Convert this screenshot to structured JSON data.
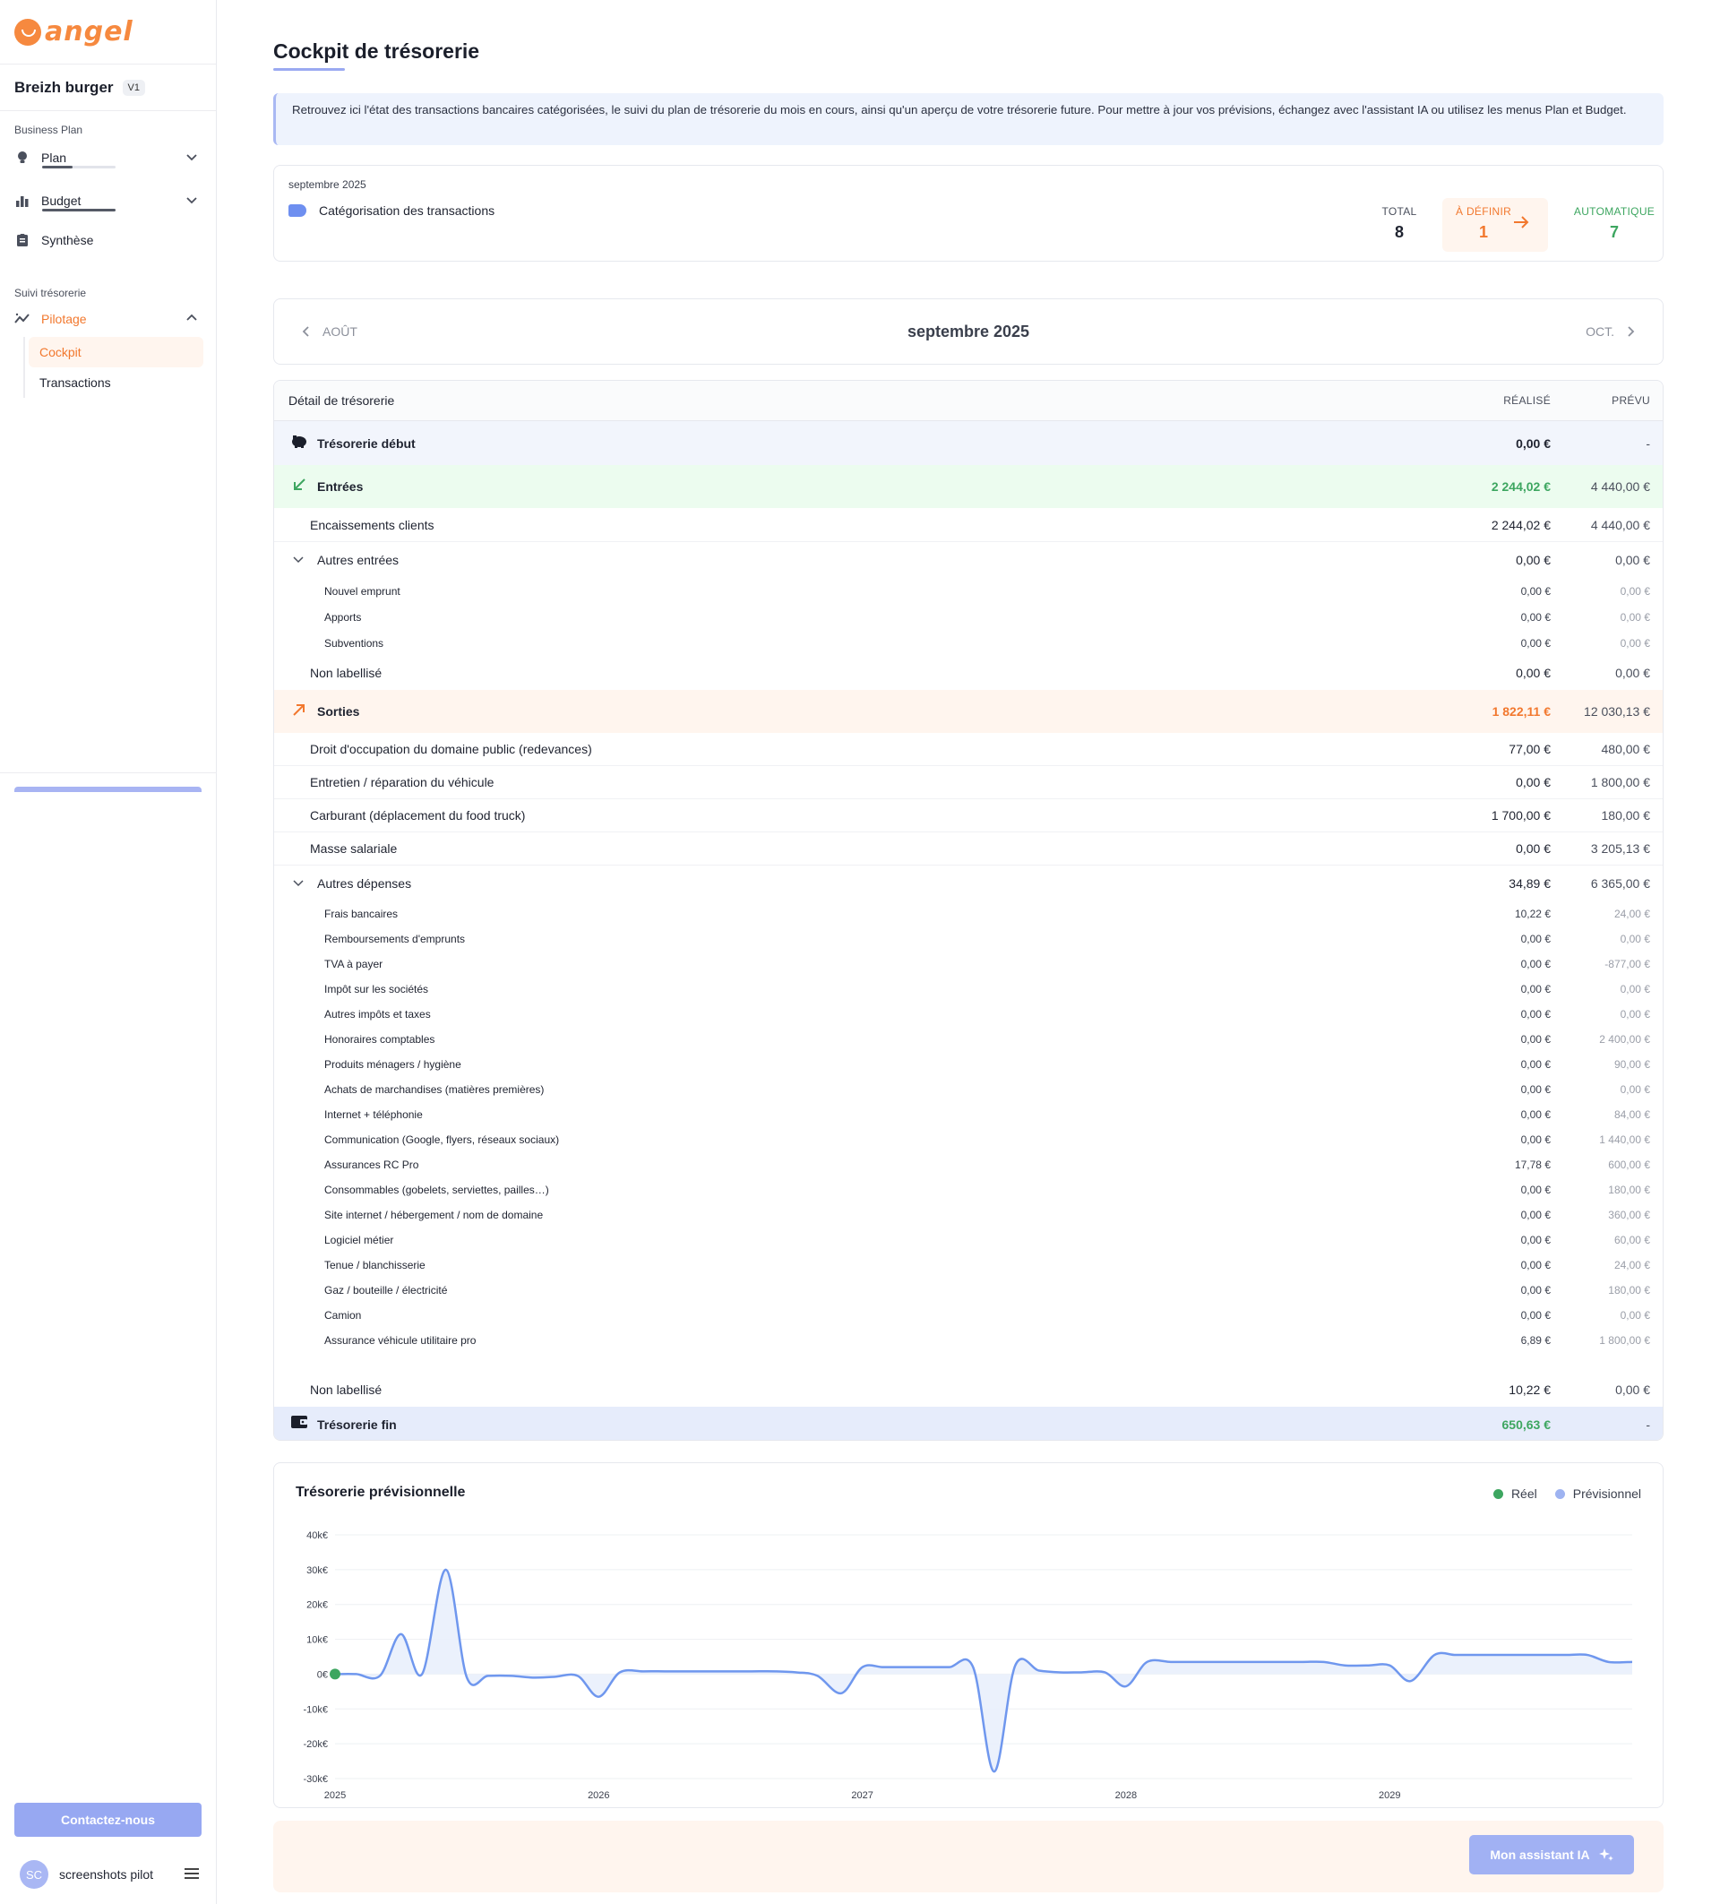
{
  "brand": {
    "name": "angel"
  },
  "project": {
    "name": "Breizh burger",
    "version": "V1"
  },
  "sidebar": {
    "section_business": "Business Plan",
    "plan_label": "Plan",
    "budget_label": "Budget",
    "synthese_label": "Synthèse",
    "section_suivi": "Suivi trésorerie",
    "pilotage_label": "Pilotage",
    "sub_items": [
      "Cockpit",
      "Transactions"
    ],
    "contact_label": "Contactez-nous",
    "user_initials": "SC",
    "user_name": "screenshots pilot"
  },
  "page": {
    "title": "Cockpit de trésorerie",
    "info": "Retrouvez ici l'état des transactions bancaires catégorisées, le suivi du plan de trésorerie du mois en cours, ainsi qu'un aperçu de votre trésorerie future. Pour mettre à jour vos prévisions, échangez avec l'assistant IA ou utilisez les menus Plan et Budget."
  },
  "categorisation": {
    "month": "septembre 2025",
    "label": "Catégorisation des transactions",
    "total_label": "TOTAL",
    "total_value": "8",
    "define_label": "À DÉFINIR",
    "define_value": "1",
    "auto_label": "AUTOMATIQUE",
    "auto_value": "7"
  },
  "month_nav": {
    "prev": "AOÛT",
    "current": "septembre 2025",
    "next": "OCT."
  },
  "treasury": {
    "header": {
      "label": "Détail de trésorerie",
      "realise": "RÉALISÉ",
      "prevu": "PRÉVU"
    },
    "debut": {
      "label": "Trésorerie début",
      "realise": "0,00 €",
      "prevu": "-"
    },
    "entrees": {
      "label": "Entrées",
      "realise": "2 244,02 €",
      "prevu": "4 440,00 €"
    },
    "encaissements": {
      "label": "Encaissements clients",
      "realise": "2 244,02 €",
      "prevu": "4 440,00 €"
    },
    "autres_entrees": {
      "label": "Autres entrées",
      "realise": "0,00 €",
      "prevu": "0,00 €"
    },
    "autres_entrees_items": [
      {
        "label": "Nouvel emprunt",
        "realise": "0,00 €",
        "prevu": "0,00 €"
      },
      {
        "label": "Apports",
        "realise": "0,00 €",
        "prevu": "0,00 €"
      },
      {
        "label": "Subventions",
        "realise": "0,00 €",
        "prevu": "0,00 €"
      }
    ],
    "non_labellise_in": {
      "label": "Non labellisé",
      "realise": "0,00 €",
      "prevu": "0,00 €"
    },
    "sorties": {
      "label": "Sorties",
      "realise": "1 822,11 €",
      "prevu": "12 030,13 €"
    },
    "sorties_items": [
      {
        "label": "Droit d'occupation du domaine public (redevances)",
        "realise": "77,00 €",
        "prevu": "480,00 €"
      },
      {
        "label": "Entretien / réparation du véhicule",
        "realise": "0,00 €",
        "prevu": "1 800,00 €"
      },
      {
        "label": "Carburant (déplacement du food truck)",
        "realise": "1 700,00 €",
        "prevu": "180,00 €"
      },
      {
        "label": "Masse salariale",
        "realise": "0,00 €",
        "prevu": "3 205,13 €"
      }
    ],
    "autres_depenses": {
      "label": "Autres dépenses",
      "realise": "34,89 €",
      "prevu": "6 365,00 €"
    },
    "autres_depenses_items": [
      {
        "label": "Frais bancaires",
        "realise": "10,22 €",
        "prevu": "24,00 €"
      },
      {
        "label": "Remboursements d'emprunts",
        "realise": "0,00 €",
        "prevu": "0,00 €"
      },
      {
        "label": "TVA à payer",
        "realise": "0,00 €",
        "prevu": "-877,00 €"
      },
      {
        "label": "Impôt sur les sociétés",
        "realise": "0,00 €",
        "prevu": "0,00 €"
      },
      {
        "label": "Autres impôts et taxes",
        "realise": "0,00 €",
        "prevu": "0,00 €"
      },
      {
        "label": "Honoraires comptables",
        "realise": "0,00 €",
        "prevu": "2 400,00 €"
      },
      {
        "label": "Produits ménagers / hygiène",
        "realise": "0,00 €",
        "prevu": "90,00 €"
      },
      {
        "label": "Achats de marchandises (matières premières)",
        "realise": "0,00 €",
        "prevu": "0,00 €"
      },
      {
        "label": "Internet + téléphonie",
        "realise": "0,00 €",
        "prevu": "84,00 €"
      },
      {
        "label": "Communication (Google, flyers, réseaux sociaux)",
        "realise": "0,00 €",
        "prevu": "1 440,00 €"
      },
      {
        "label": "Assurances RC Pro",
        "realise": "17,78 €",
        "prevu": "600,00 €"
      },
      {
        "label": "Consommables (gobelets, serviettes, pailles…)",
        "realise": "0,00 €",
        "prevu": "180,00 €"
      },
      {
        "label": "Site internet / hébergement / nom de domaine",
        "realise": "0,00 €",
        "prevu": "360,00 €"
      },
      {
        "label": "Logiciel métier",
        "realise": "0,00 €",
        "prevu": "60,00 €"
      },
      {
        "label": "Tenue / blanchisserie",
        "realise": "0,00 €",
        "prevu": "24,00 €"
      },
      {
        "label": "Gaz / bouteille / électricité",
        "realise": "0,00 €",
        "prevu": "180,00 €"
      },
      {
        "label": "Camion",
        "realise": "0,00 €",
        "prevu": "0,00 €"
      },
      {
        "label": "Assurance véhicule utilitaire pro",
        "realise": "6,89 €",
        "prevu": "1 800,00 €"
      }
    ],
    "non_labellise_out": {
      "label": "Non labellisé",
      "realise": "10,22 €",
      "prevu": "0,00 €"
    },
    "fin": {
      "label": "Trésorerie fin",
      "realise": "650,63 €",
      "prevu": "-"
    }
  },
  "chart_data": {
    "type": "line",
    "title": "Trésorerie prévisionnelle",
    "legend": [
      "Réel",
      "Prévisionnel"
    ],
    "legend_placement": "top-right",
    "colors": {
      "reel": "#3da660",
      "previsionnel": "#6f97ee",
      "area": "#e9effc"
    },
    "y_ticks": [
      "40k€",
      "30k€",
      "20k€",
      "10k€",
      "0€",
      "-10k€",
      "-20k€",
      "-30k€"
    ],
    "ylim": [
      -30000,
      40000
    ],
    "x_ticks": [
      "2025",
      "2026",
      "2027",
      "2028",
      "2029"
    ],
    "xlim": [
      2025.0,
      2029.92
    ],
    "grid": true,
    "series": [
      {
        "name": "Prévisionnel",
        "x": [
          2025.0,
          2025.08,
          2025.17,
          2025.25,
          2025.33,
          2025.42,
          2025.5,
          2025.58,
          2025.67,
          2025.75,
          2025.83,
          2025.92,
          2026.0,
          2026.08,
          2026.17,
          2026.25,
          2026.33,
          2026.42,
          2026.5,
          2026.58,
          2026.67,
          2026.75,
          2026.83,
          2026.92,
          2027.0,
          2027.08,
          2027.17,
          2027.25,
          2027.33,
          2027.42,
          2027.5,
          2027.58,
          2027.67,
          2027.75,
          2027.83,
          2027.92,
          2028.0,
          2028.08,
          2028.17,
          2028.25,
          2028.33,
          2028.42,
          2028.5,
          2028.58,
          2028.67,
          2028.75,
          2028.83,
          2028.92,
          2029.0,
          2029.08,
          2029.17,
          2029.25,
          2029.33,
          2029.42,
          2029.5,
          2029.58,
          2029.67,
          2029.75,
          2029.83,
          2029.92
        ],
        "values": [
          0,
          0,
          -500,
          11500,
          0,
          30000,
          -1000,
          -500,
          -500,
          -1000,
          -800,
          -500,
          -6500,
          500,
          800,
          800,
          800,
          800,
          800,
          800,
          800,
          500,
          -500,
          -5500,
          2000,
          2000,
          2000,
          2000,
          2000,
          2000,
          -28000,
          2500,
          1000,
          500,
          500,
          500,
          -3500,
          3500,
          3500,
          3500,
          3500,
          3500,
          3500,
          3500,
          3500,
          3500,
          2500,
          2500,
          2500,
          -2000,
          5500,
          5500,
          5500,
          5500,
          5500,
          5500,
          5500,
          5500,
          3500,
          3500
        ]
      },
      {
        "name": "Réel",
        "x": [
          2025.0
        ],
        "values": [
          0
        ]
      }
    ]
  },
  "assistant": {
    "label": "Mon assistant IA"
  }
}
